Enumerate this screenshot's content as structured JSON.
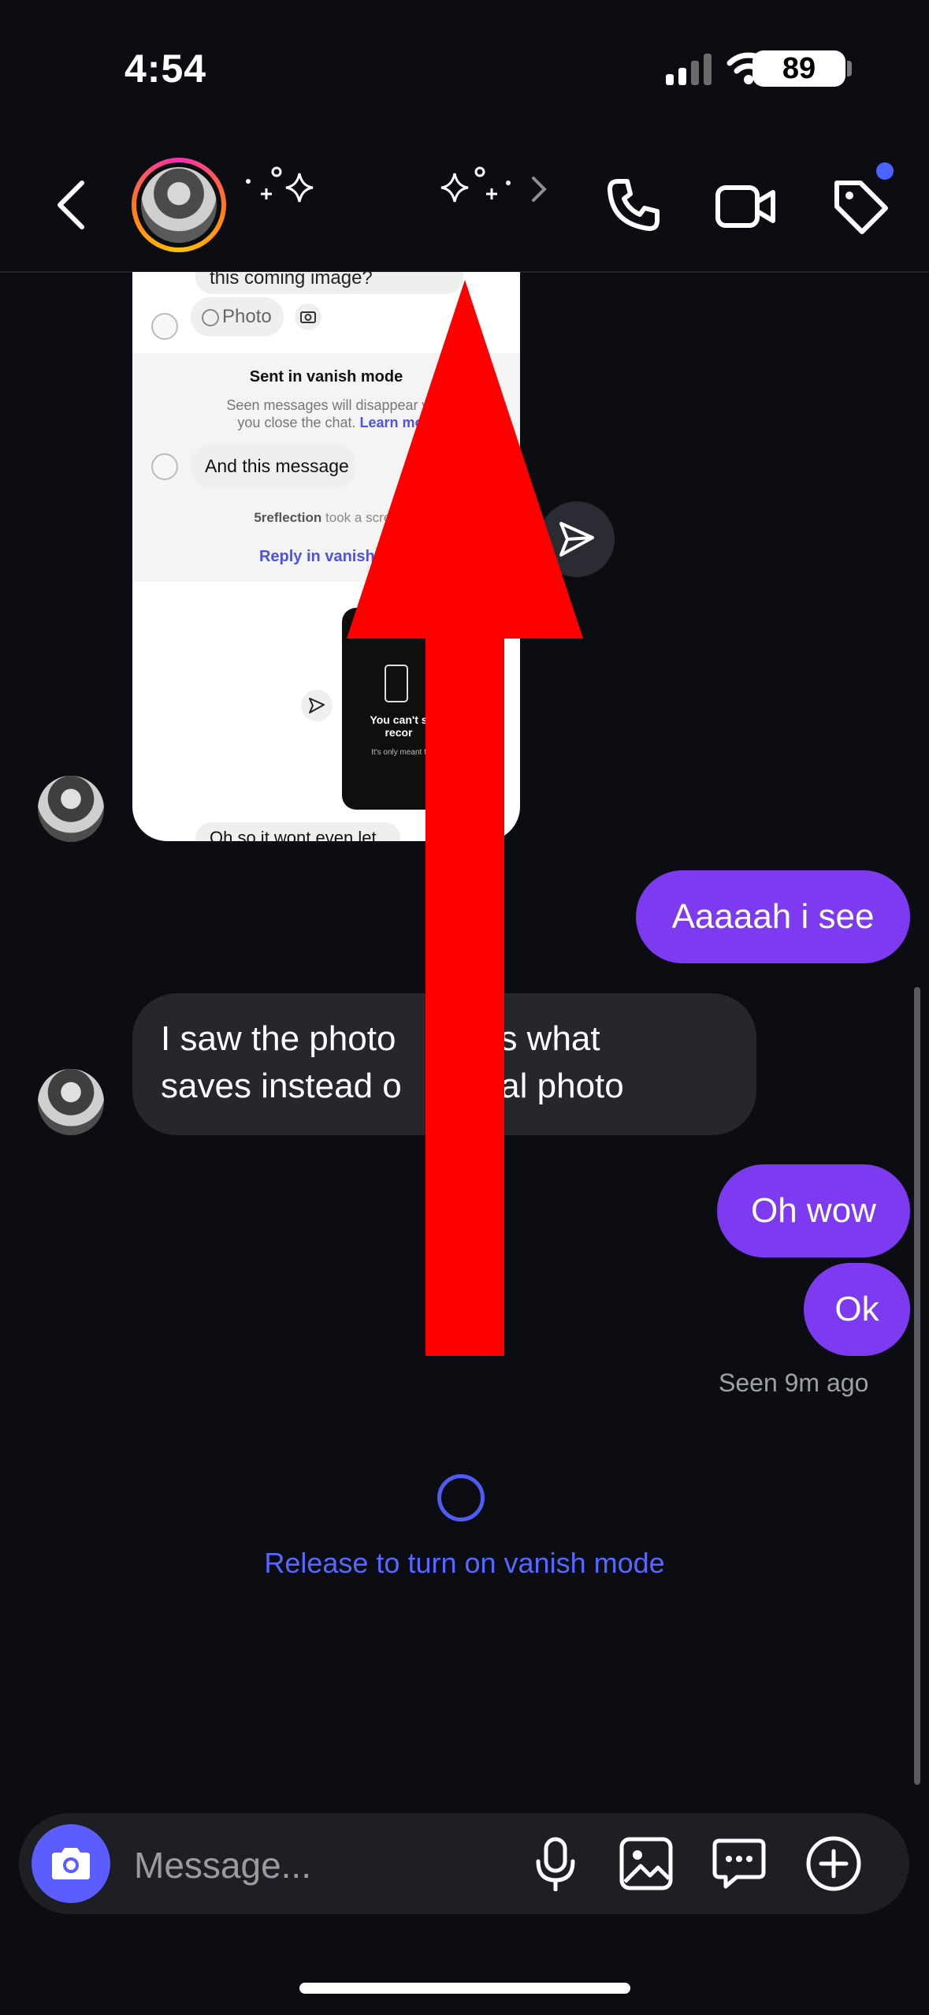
{
  "status_bar": {
    "time": "4:54",
    "battery": "89"
  },
  "header": {
    "back_icon": "chevron-left-icon",
    "sparkle_icon": "sparkles-icon",
    "chevron_icon": "chevron-right-icon",
    "call_icon": "phone-icon",
    "video_icon": "video-camera-icon",
    "tag_icon": "tag-icon",
    "badge_color": "#4a63ff"
  },
  "shared_card": {
    "top_bubble": "this coming image?",
    "photo_chip": "Photo",
    "sent_title": "Sent in vanish mode",
    "sent_sub": "Seen messages will disappear wh",
    "sent_sub2": "you close the chat.",
    "learn_more": "Learn mor",
    "message": "And this message",
    "took_user": "5reflection",
    "took_text": "took a scree",
    "reply": "Reply in vanish m",
    "dark_title": "You can't s",
    "dark_title2": "recor",
    "dark_sub": "It's only meant t",
    "bottom_bubble": "Oh so it wont even let you"
  },
  "messages": [
    {
      "direction": "outgoing",
      "text": "Aaaaah i see"
    },
    {
      "direction": "incoming",
      "line1": "I saw the photo",
      "line1b": "that's what",
      "line2a": "saves instead o",
      "line2b": "actual photo"
    },
    {
      "direction": "outgoing",
      "text": "Oh wow"
    },
    {
      "direction": "outgoing",
      "text": "Ok"
    }
  ],
  "seen": "Seen 9m ago",
  "vanish_hint": "Release to turn on vanish mode",
  "composer": {
    "placeholder": "Message...",
    "camera_icon": "camera-icon",
    "mic_icon": "microphone-icon",
    "gallery_icon": "image-icon",
    "sticker_icon": "chat-bubble-icon",
    "plus_icon": "plus-circle-icon"
  },
  "colors": {
    "accent": "#5b5dff",
    "outgoing_bubble": "#7d3af0",
    "annotation_arrow": "#ff0000"
  }
}
